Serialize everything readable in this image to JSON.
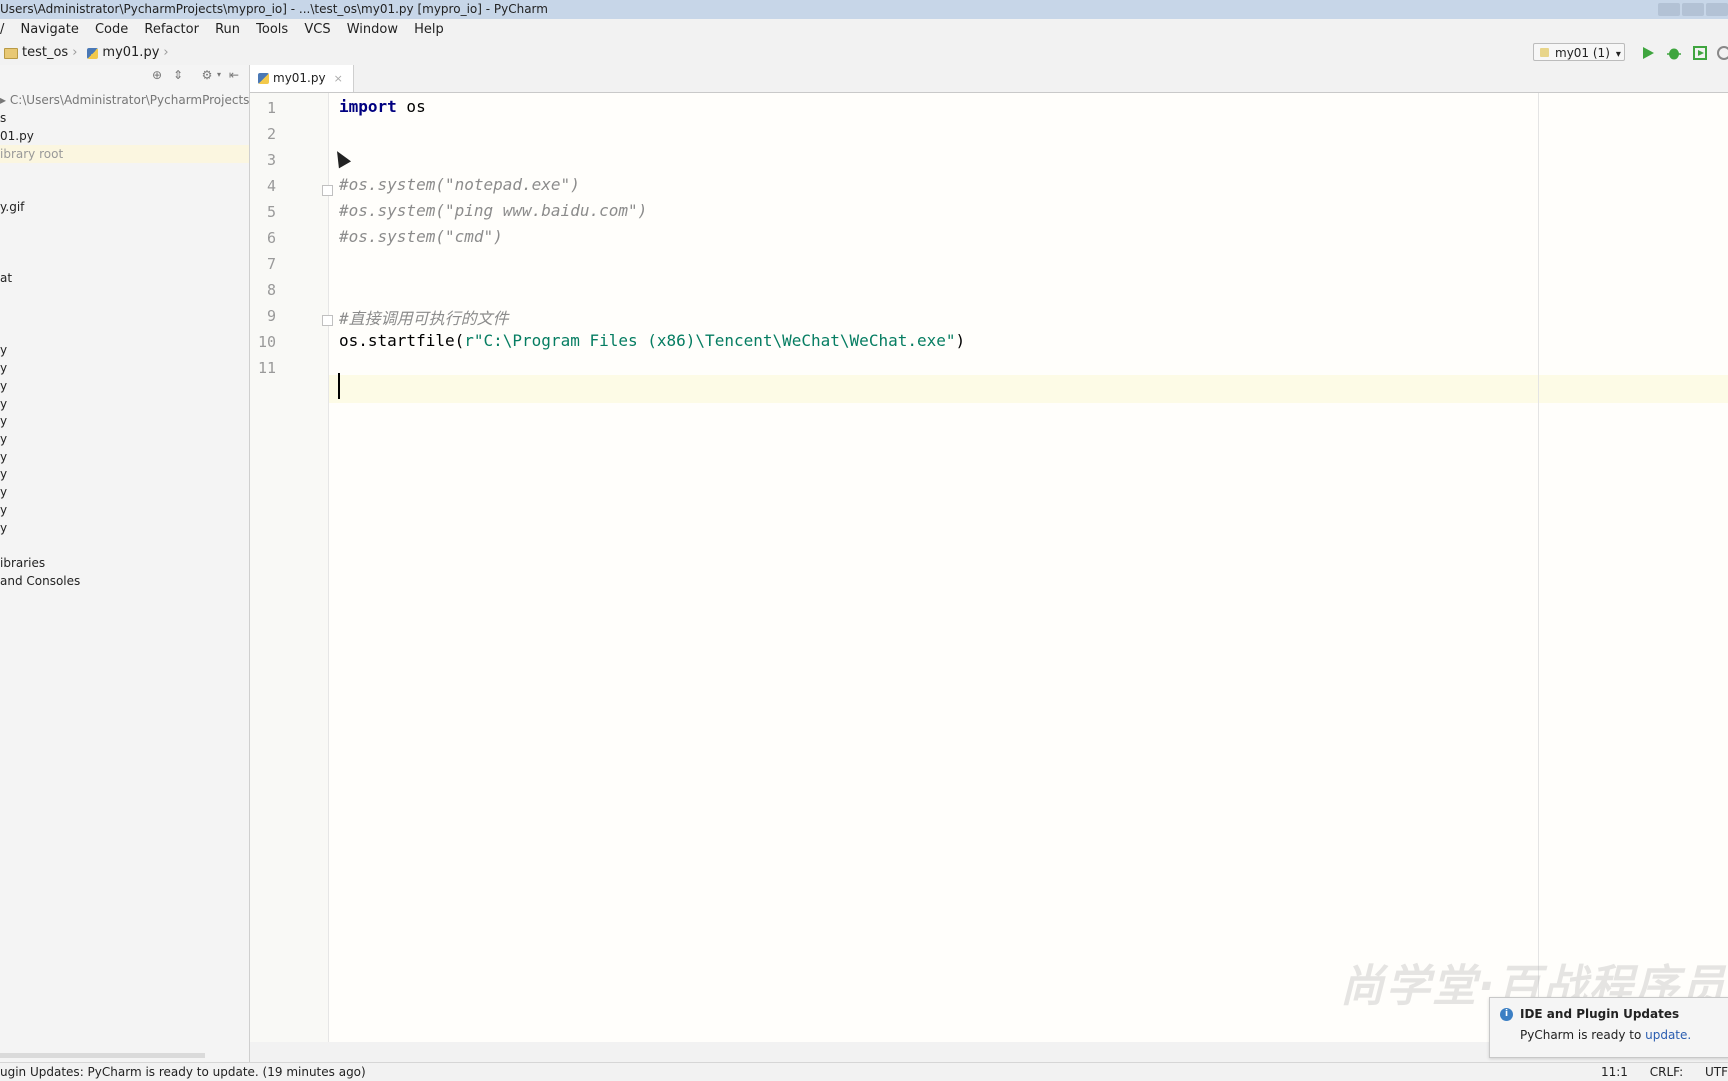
{
  "window": {
    "title": "Users\\Administrator\\PycharmProjects\\mypro_io] - ...\\test_os\\my01.py [mypro_io] - PyCharm"
  },
  "menu": [
    "/",
    "Navigate",
    "Code",
    "Refactor",
    "Run",
    "Tools",
    "VCS",
    "Window",
    "Help"
  ],
  "breadcrumb": {
    "folder": "test_os",
    "file": "my01.py"
  },
  "run_config": {
    "label": "my01 (1)"
  },
  "project": {
    "root_path": "C:\\Users\\Administrator\\PycharmProjects\\r",
    "items": [
      "s",
      "01.py",
      "ibrary root",
      "y.gif",
      "at",
      "y",
      "y",
      "y",
      "y",
      "y",
      "y",
      "y",
      "y",
      "y",
      "y",
      "y",
      "ibraries",
      "and Consoles"
    ]
  },
  "editor": {
    "tab": "my01.py",
    "line_numbers": [
      "1",
      "2",
      "3",
      "4",
      "5",
      "6",
      "7",
      "8",
      "9",
      "10",
      "11"
    ],
    "code": {
      "l1_kw": "import",
      "l1_rest": " os",
      "l4": "#os.system(\"notepad.exe\")",
      "l5": "#os.system(\"ping www.baidu.com\")",
      "l6": "#os.system(\"cmd\")",
      "l9": "#直接调用可执行的文件",
      "l10_fn": "os.startfile(",
      "l10_str": "r\"C:\\Program Files (x86)\\Tencent\\WeChat\\WeChat.exe\"",
      "l10_end": ")"
    }
  },
  "status": {
    "message": "ugin Updates: PyCharm is ready to update. (19 minutes ago)",
    "position": "11:1",
    "line_sep": "CRLF:",
    "encoding": "UTF"
  },
  "notification": {
    "title": "IDE and Plugin Updates",
    "message": "PyCharm is ready to ",
    "link": "update."
  },
  "watermark": "尚学堂·百战程序员"
}
